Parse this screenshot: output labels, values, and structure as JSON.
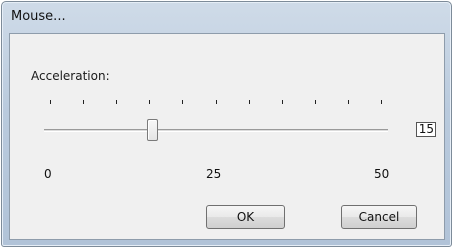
{
  "window": {
    "title": "Mouse..."
  },
  "settings": {
    "acceleration_label": "Acceleration:",
    "slider": {
      "value": 15,
      "min": 0,
      "max": 50,
      "tick_count": 11
    },
    "value_display": "15",
    "scale_labels": [
      "0",
      "25",
      "50"
    ]
  },
  "buttons": {
    "ok_label": "OK",
    "cancel_label": "Cancel"
  }
}
